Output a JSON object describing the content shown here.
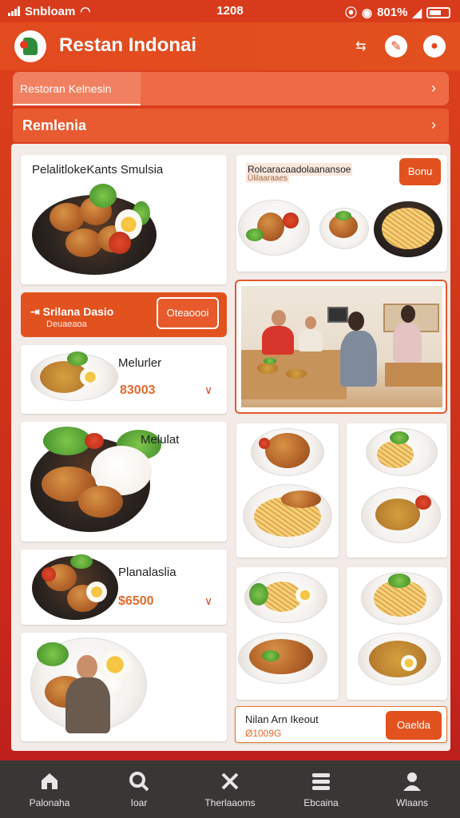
{
  "status_bar": {
    "carrier": "Snbloam",
    "time": "1208",
    "battery": "801%"
  },
  "header": {
    "title": "Restan Indonai",
    "icons": [
      "share-icon",
      "edit-icon",
      "profile-icon"
    ]
  },
  "breadcrumb": {
    "label": "Restoran Kelnesin"
  },
  "section": {
    "title": "Remlenia"
  },
  "cards": {
    "featured": {
      "title": "PelalitlokeKants Smulsia"
    },
    "platter": {
      "title": "Rolcaracaadolaanansoe",
      "subtitle": "Ülilaaraaes",
      "button": "Bonu"
    },
    "promo": {
      "label": "Srilana Dasio",
      "sub": "Deuaeaoa",
      "button": "Oteaoooi"
    },
    "item1": {
      "title": "Melurler",
      "price": "83003"
    },
    "item2": {
      "title": "Melulat"
    },
    "item3": {
      "title": "Planalaslia",
      "price": "$6500"
    },
    "footer": {
      "title": "Nilan Arn Ikeout",
      "price": "Ø1009G",
      "button": "Oaelda"
    }
  },
  "bottom_nav": [
    {
      "label": "Palonaha",
      "icon": "home-icon"
    },
    {
      "label": "Ioar",
      "icon": "search-icon"
    },
    {
      "label": "Therlaaoms",
      "icon": "utensils-icon"
    },
    {
      "label": "Ebcaina",
      "icon": "list-icon"
    },
    {
      "label": "Wlaans",
      "icon": "user-icon"
    }
  ]
}
